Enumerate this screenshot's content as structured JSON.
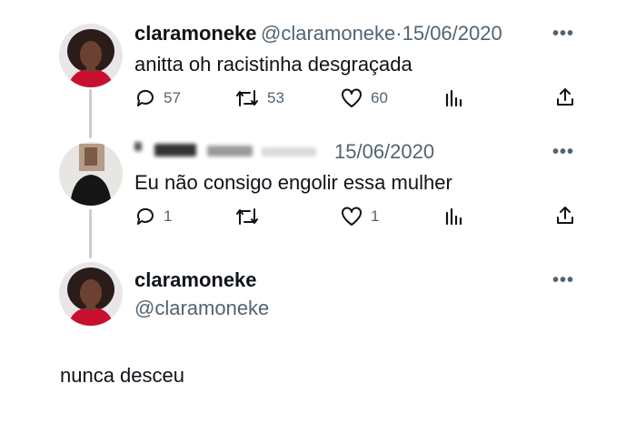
{
  "tweets": [
    {
      "name": "claramoneke",
      "handle": "@claramoneke",
      "separator": "·",
      "date": "15/06/2020",
      "text": "anitta oh racistinha desgraçada",
      "actions": {
        "replies": "57",
        "retweets": "53",
        "likes": "60"
      }
    },
    {
      "name": "",
      "handle": "",
      "date": "15/06/2020",
      "text": "Eu não consigo engolir essa mulher",
      "actions": {
        "replies": "1",
        "retweets": "",
        "likes": "1"
      }
    }
  ],
  "main_tweet": {
    "name": "claramoneke",
    "handle": "@claramoneke",
    "text": "nunca desceu"
  },
  "icons": {
    "reply": "reply-icon",
    "retweet": "retweet-icon",
    "like": "heart-icon",
    "views": "analytics-icon",
    "share": "share-icon",
    "more": "more-icon"
  },
  "colors": {
    "text": "#0f1419",
    "secondary": "#536471",
    "thread_line": "#c9ced3",
    "avatar_red": "#c8102e"
  }
}
